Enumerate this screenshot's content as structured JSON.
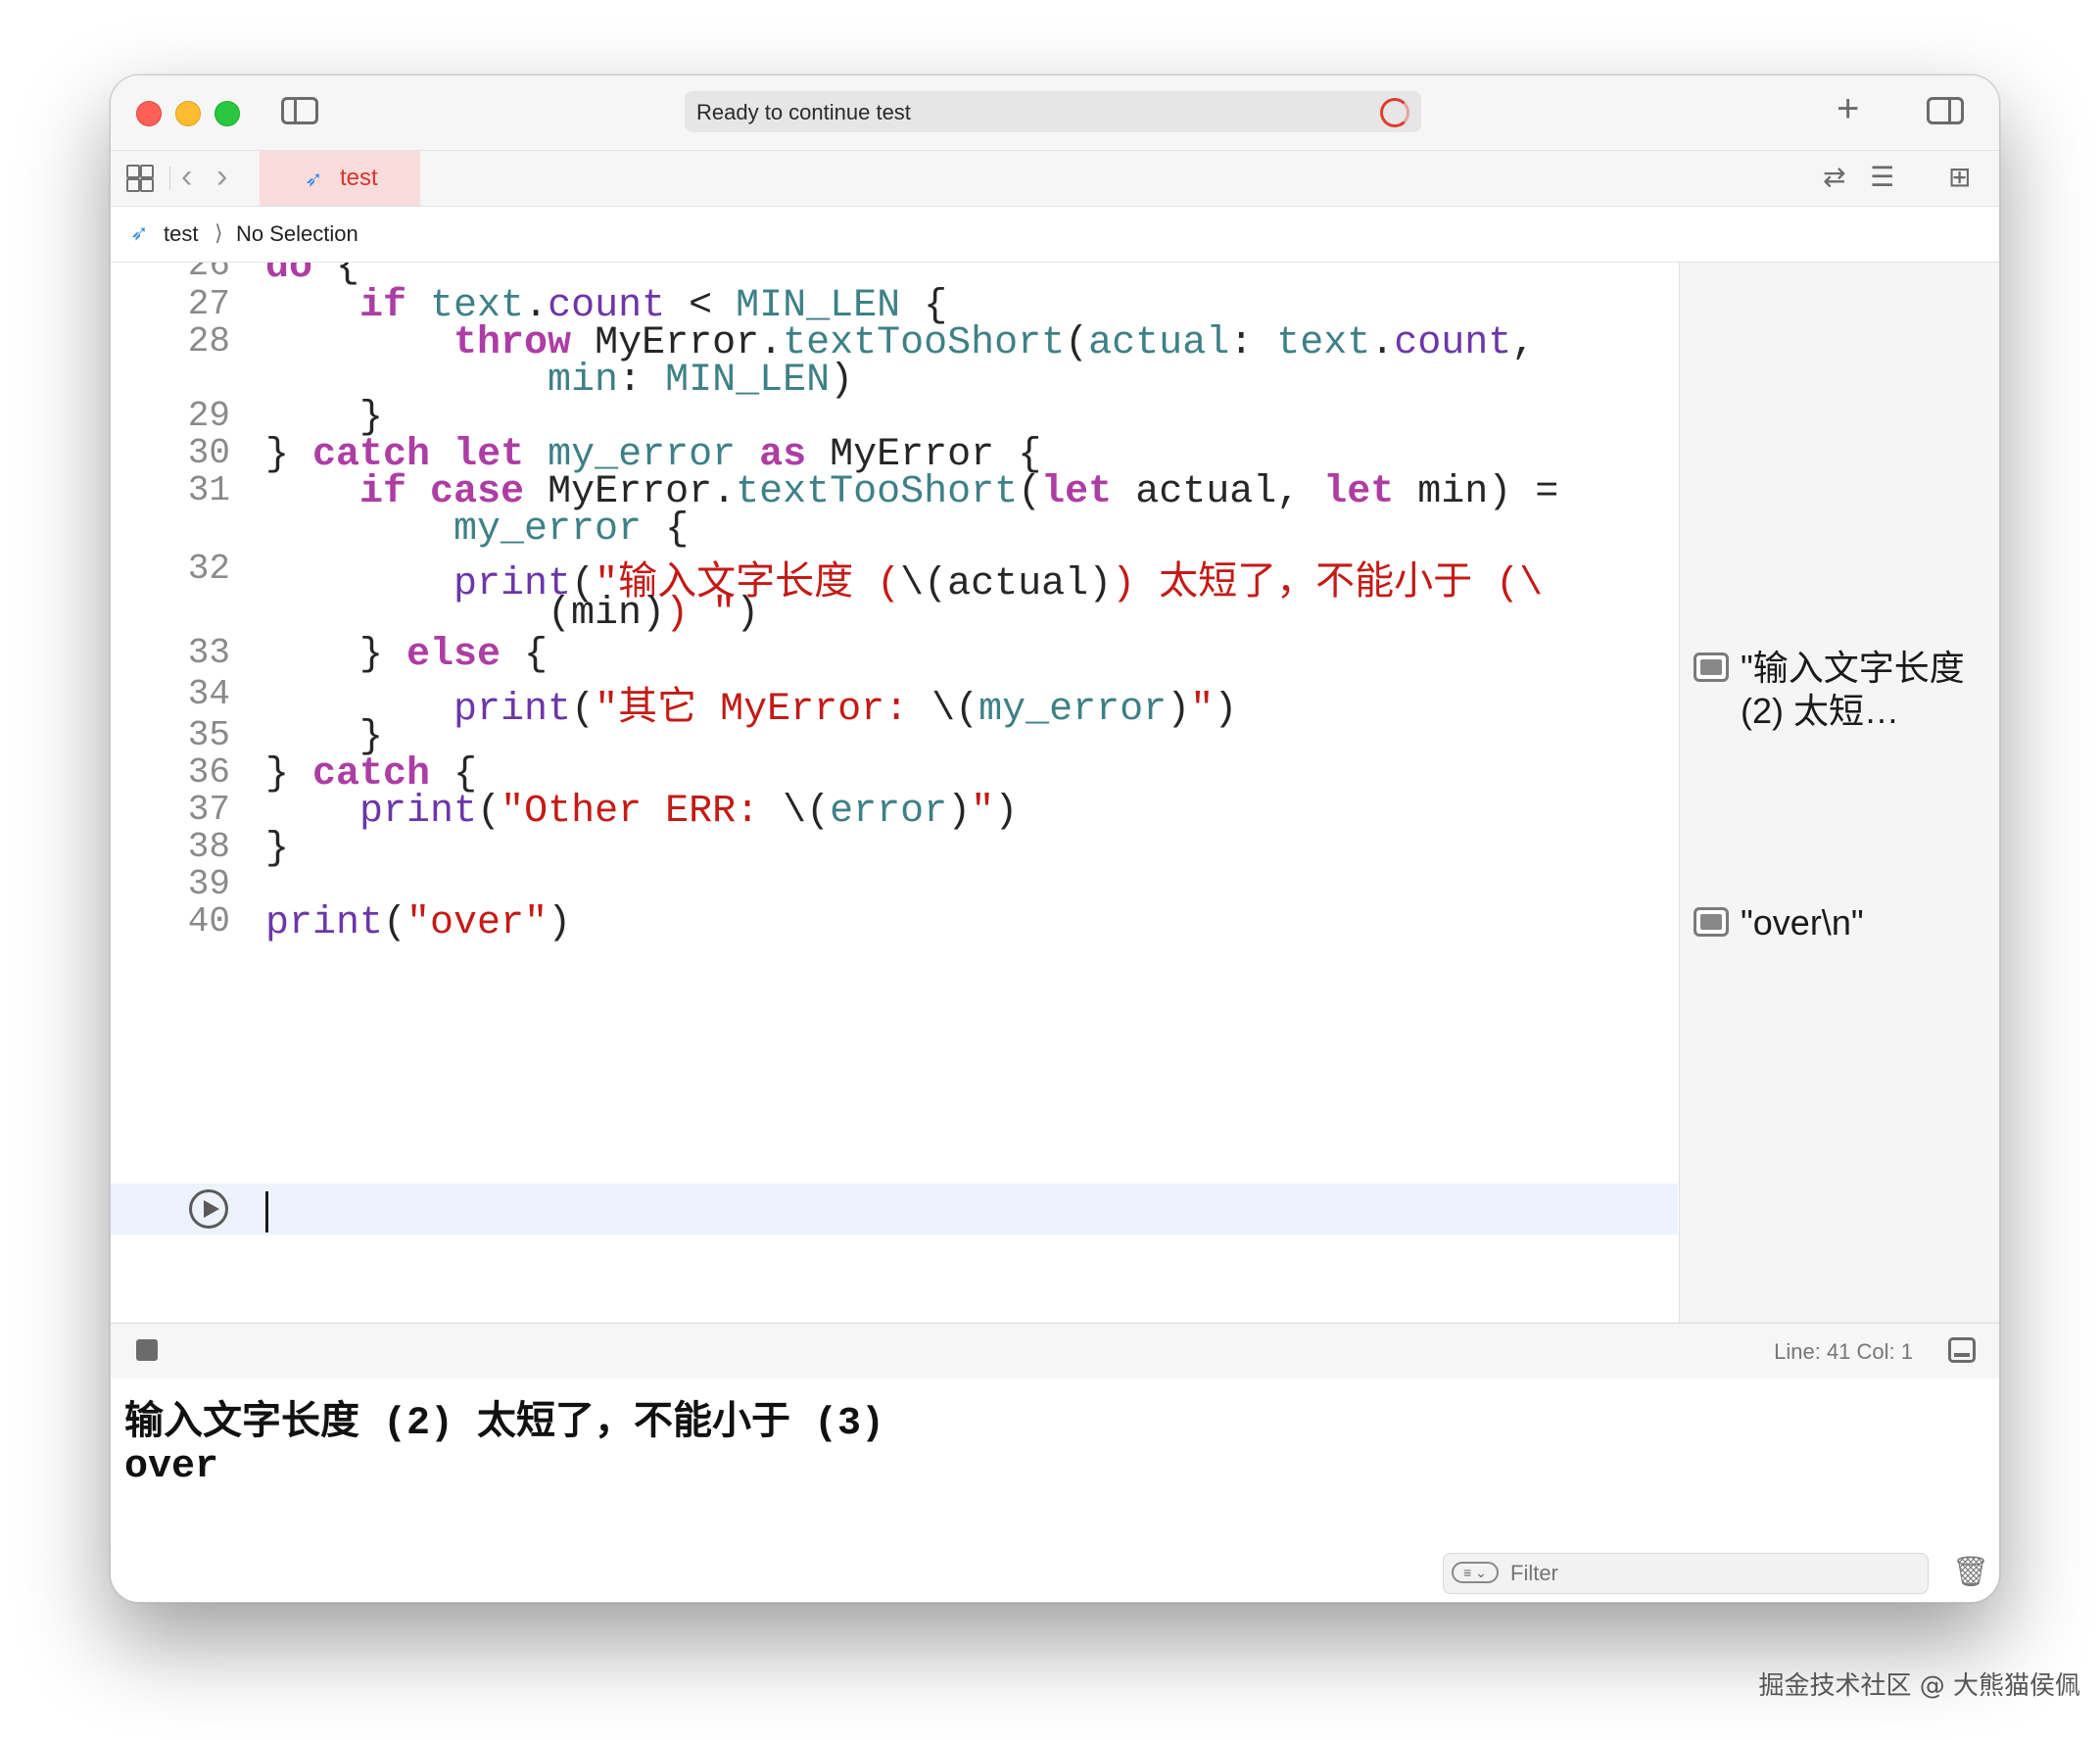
{
  "titlebar": {
    "status": "Ready to continue test"
  },
  "tabbar": {
    "active_tab": "test"
  },
  "breadcrumb": {
    "file": "test",
    "selection": "No Selection"
  },
  "editor": {
    "lines": [
      {
        "num": "26",
        "text": "do {"
      },
      {
        "num": "27",
        "text": "    if text.count < MIN_LEN {"
      },
      {
        "num": "28",
        "text": "        throw MyError.textTooShort(actual: text.count,"
      },
      {
        "num": "",
        "text": "            min: MIN_LEN)"
      },
      {
        "num": "29",
        "text": "    }"
      },
      {
        "num": "30",
        "text": "} catch let my_error as MyError {"
      },
      {
        "num": "31",
        "text": "    if case MyError.textTooShort(let actual, let min) ="
      },
      {
        "num": "",
        "text": "        my_error {"
      },
      {
        "num": "32",
        "text": "        print(\"输入文字长度 (\\(actual)) 太短了，不能小于 (\\"
      },
      {
        "num": "",
        "text": "            (min)) \")"
      },
      {
        "num": "33",
        "text": "    } else {"
      },
      {
        "num": "34",
        "text": "        print(\"其它 MyError: \\(my_error)\")"
      },
      {
        "num": "35",
        "text": "    }"
      },
      {
        "num": "36",
        "text": "} catch {"
      },
      {
        "num": "37",
        "text": "    print(\"Other ERR: \\(error)\")"
      },
      {
        "num": "38",
        "text": "}"
      },
      {
        "num": "39",
        "text": ""
      },
      {
        "num": "40",
        "text": "print(\"over\")"
      }
    ]
  },
  "results": {
    "r1": "\"输入文字长度 (2) 太短…",
    "r2": "\"over\\n\""
  },
  "debugbar": {
    "position": "Line: 41  Col: 1"
  },
  "console": {
    "output": [
      "输入文字长度 (2) 太短了，不能小于 (3)",
      "over"
    ],
    "filter_placeholder": "Filter"
  },
  "watermark": "掘金技术社区 @ 大熊猫侯佩",
  "colors": {
    "keyword": "#ad3da4",
    "string": "#c41a16",
    "property": "#3e8087",
    "function": "#6c36a9",
    "active_tab_bg": "#f9dcdc"
  }
}
